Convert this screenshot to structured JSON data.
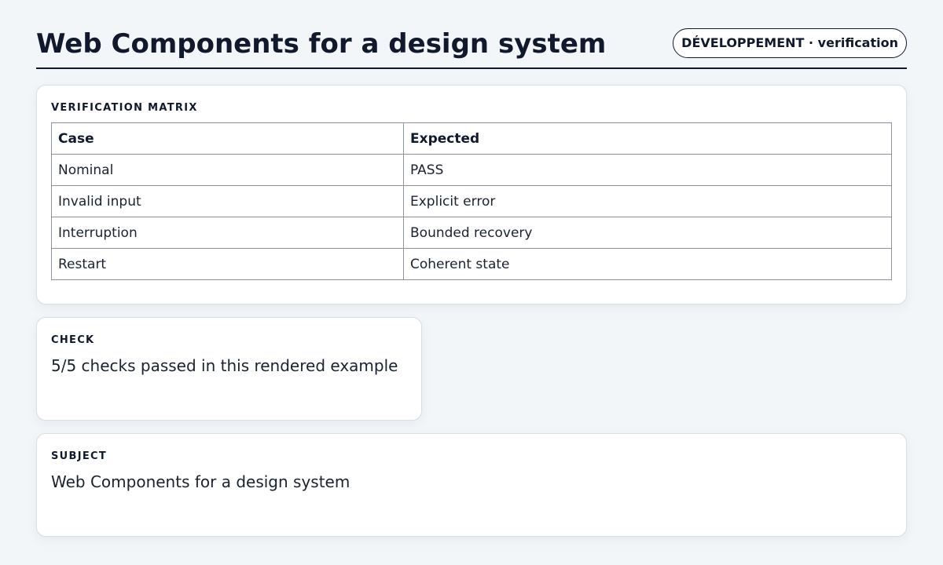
{
  "header": {
    "title": "Web Components for a design system",
    "badge": "DÉVELOPPEMENT · verification"
  },
  "matrix": {
    "label": "VERIFICATION MATRIX",
    "columns": [
      "Case",
      "Expected"
    ],
    "rows": [
      [
        "Nominal",
        "PASS"
      ],
      [
        "Invalid input",
        "Explicit error"
      ],
      [
        "Interruption",
        "Bounded recovery"
      ],
      [
        "Restart",
        "Coherent state"
      ]
    ]
  },
  "check": {
    "label": "CHECK",
    "text": "5/5 checks passed in this rendered example"
  },
  "subject": {
    "label": "SUBJECT",
    "text": "Web Components for a design system"
  }
}
